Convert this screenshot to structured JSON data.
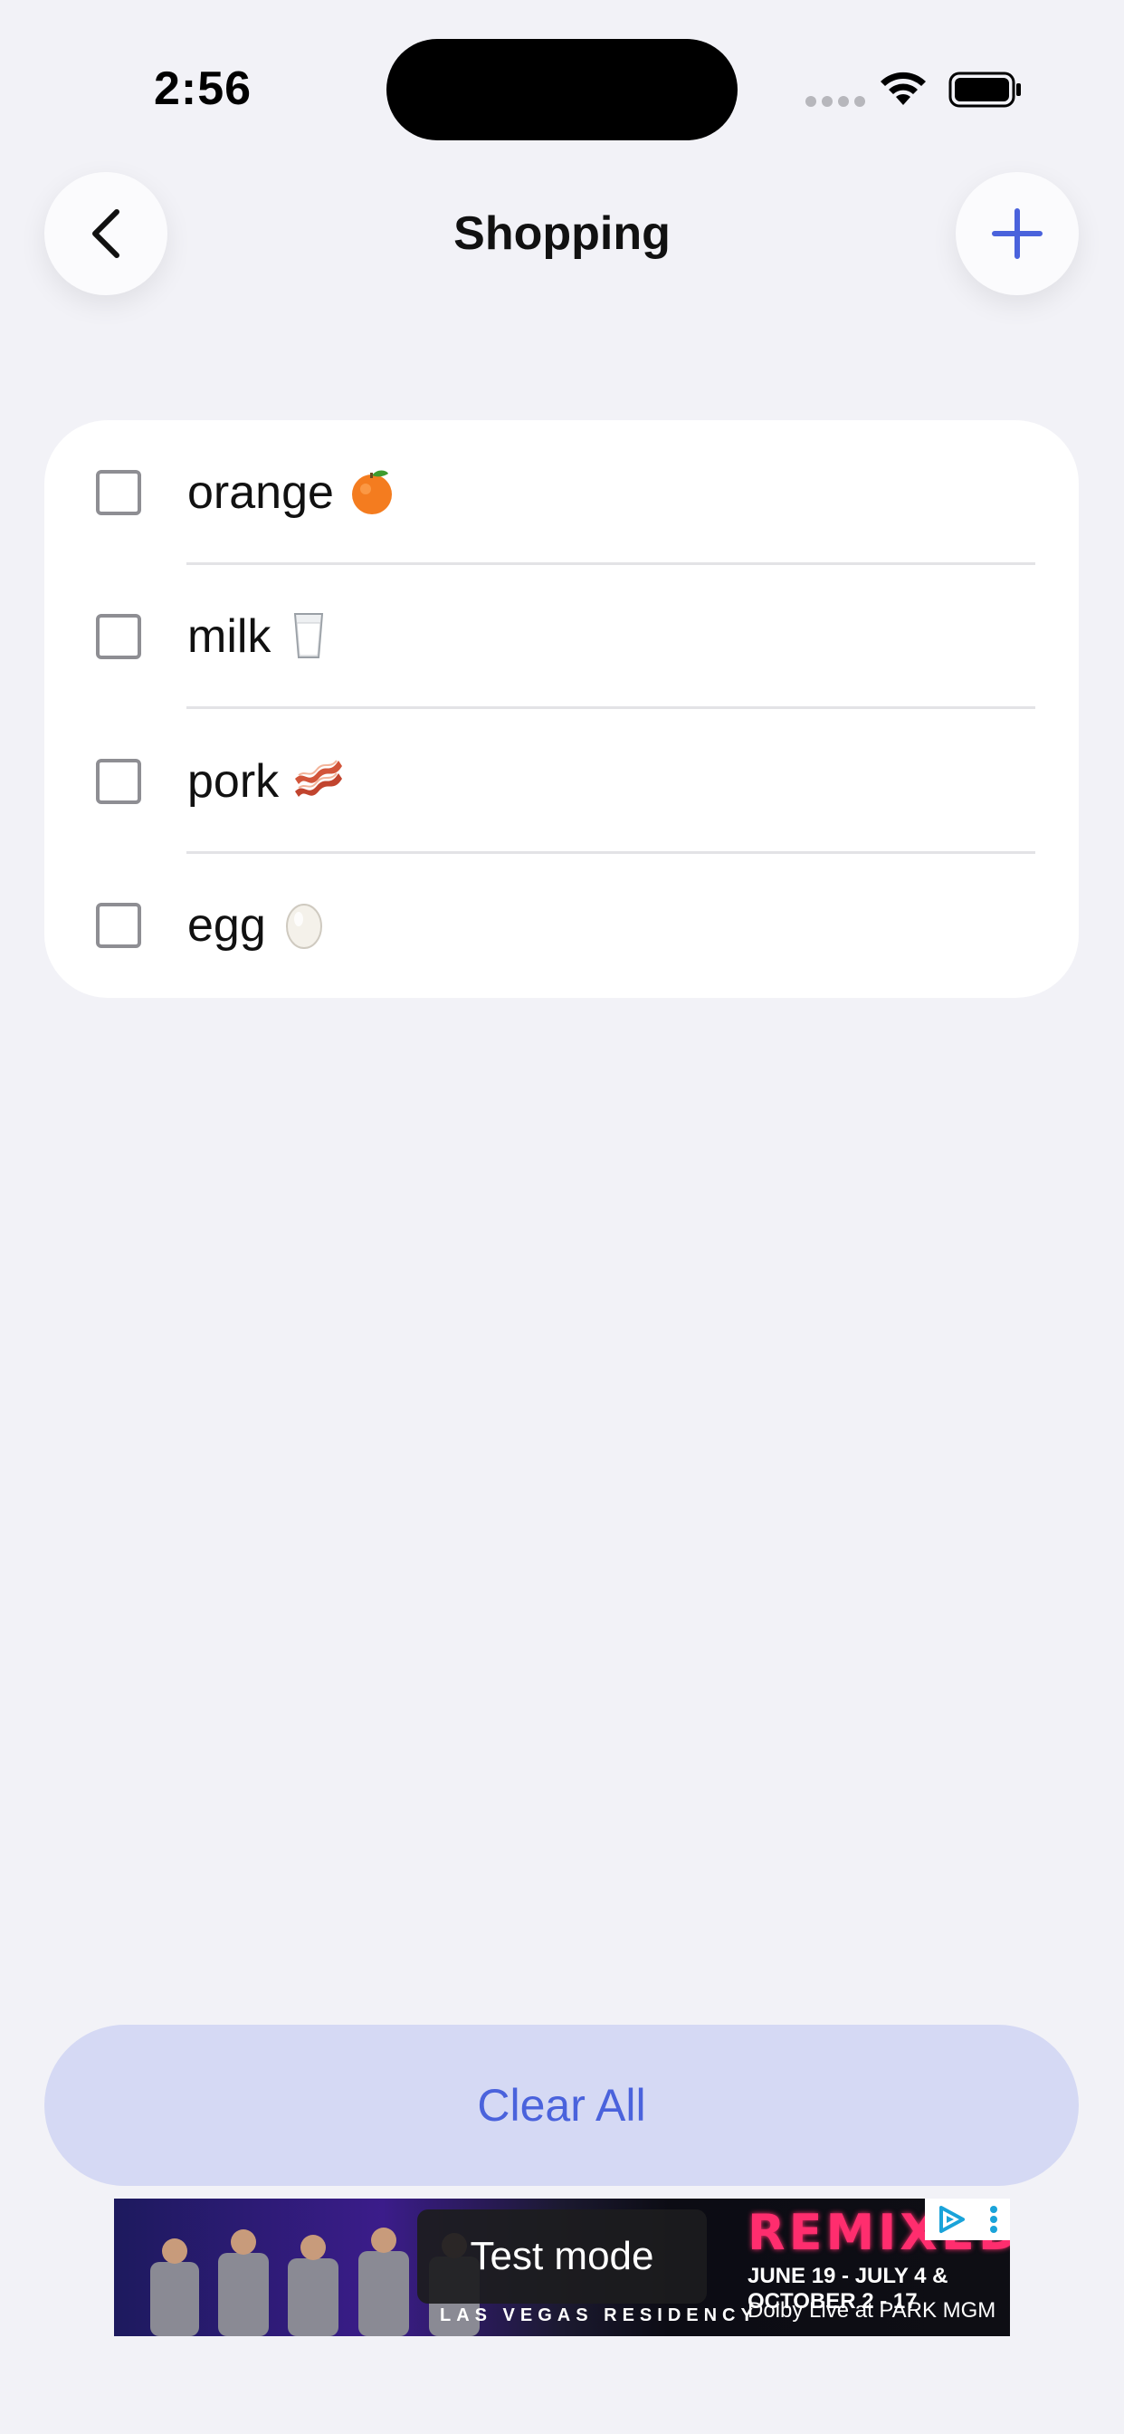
{
  "status_bar": {
    "time": "2:56"
  },
  "nav": {
    "title": "Shopping",
    "back_icon": "chevron-left-icon",
    "add_icon": "plus-icon"
  },
  "list": {
    "items": [
      {
        "label": "orange",
        "emoji": "orange-icon",
        "checked": false
      },
      {
        "label": "milk",
        "emoji": "milk-glass-icon",
        "checked": false
      },
      {
        "label": "pork",
        "emoji": "bacon-icon",
        "checked": false
      },
      {
        "label": "egg",
        "emoji": "egg-icon",
        "checked": false
      }
    ]
  },
  "clear_button": {
    "label": "Clear All"
  },
  "ad": {
    "overlay_label": "Test mode",
    "headline": "REMIXED",
    "dates": "JUNE 19 - JULY 4 & OCTOBER 2 - 17",
    "sponsor": "Dolby Live at PARK MGM",
    "residency": "LAS VEGAS RESIDENCY"
  },
  "colors": {
    "background": "#f2f2f7",
    "accent": "#4a62dc",
    "clear_button_bg": "#d5d9f4",
    "card_bg": "#ffffff"
  }
}
